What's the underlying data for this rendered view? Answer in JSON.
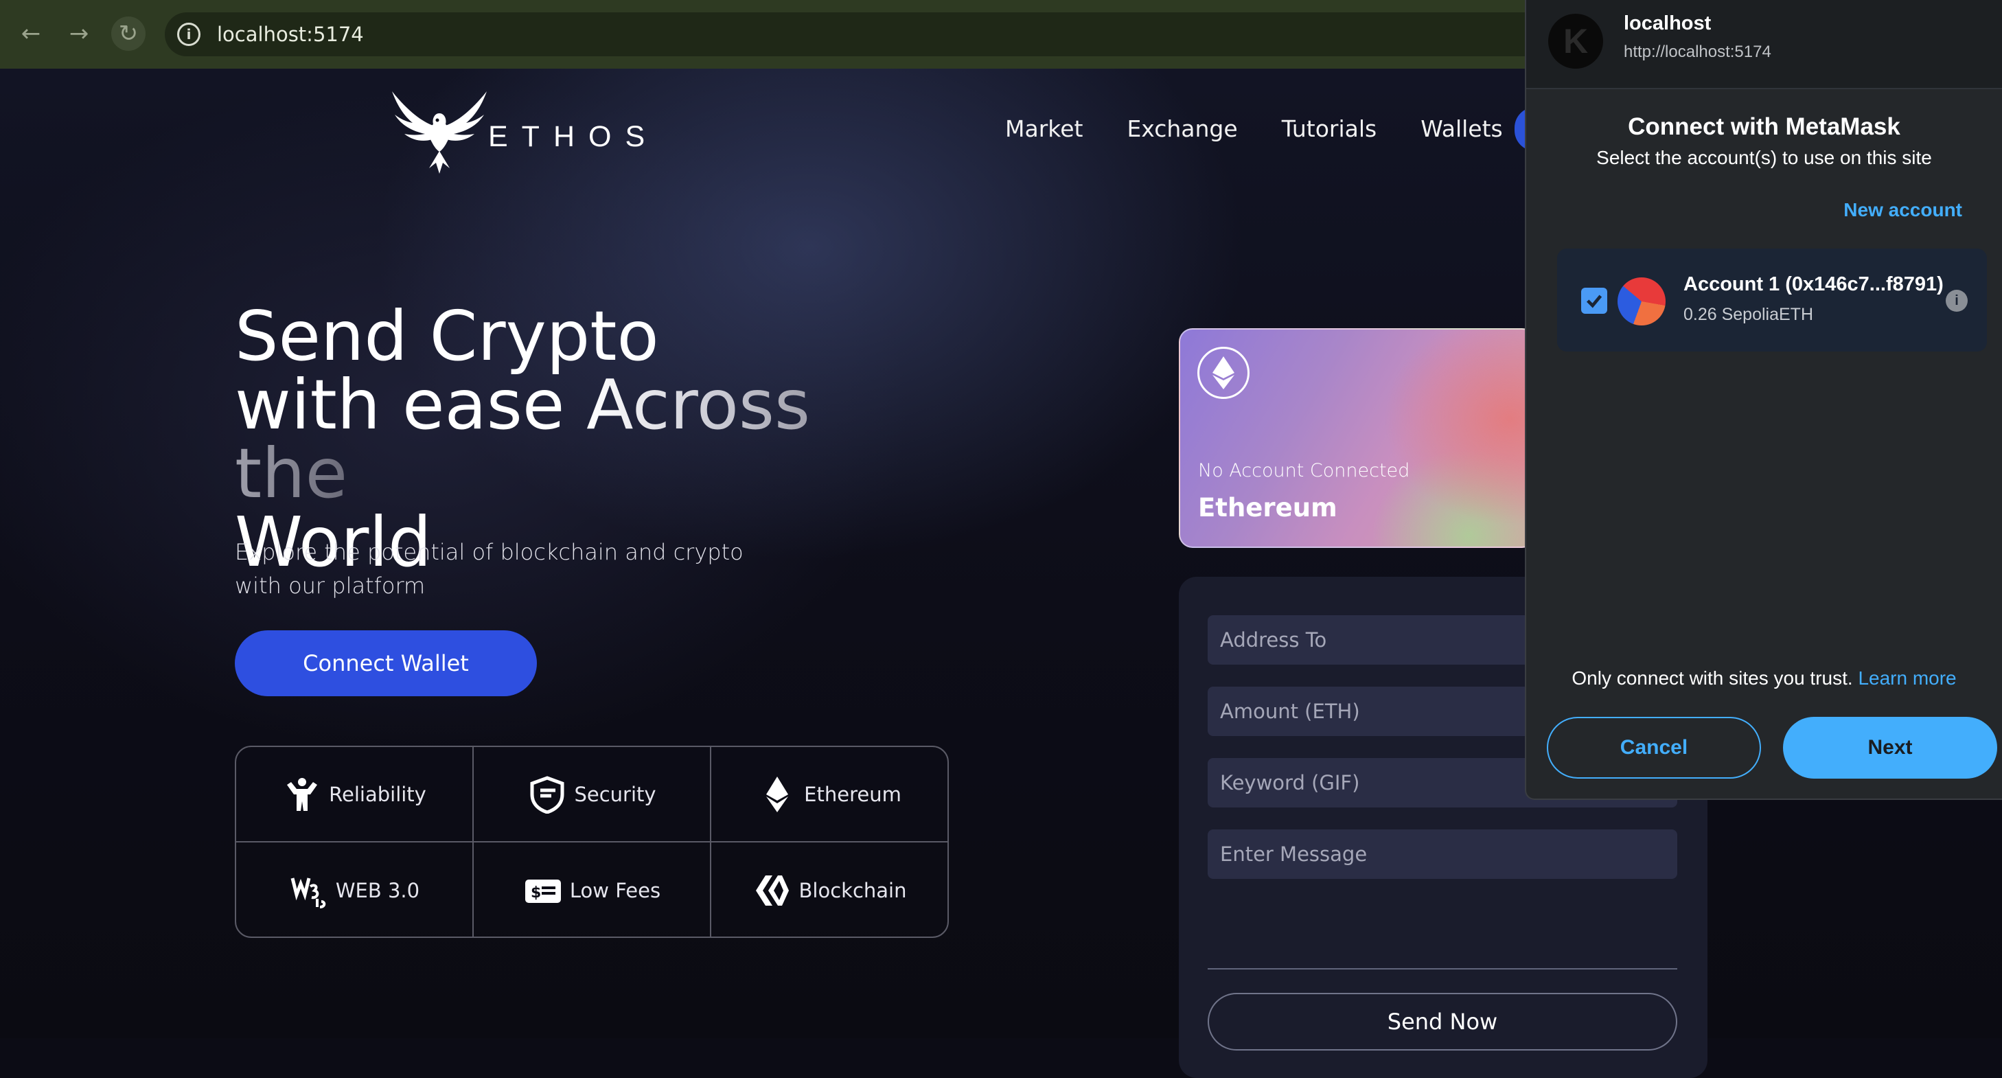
{
  "browser": {
    "url": "localhost:5174",
    "back_icon": "back-arrow-icon",
    "forward_icon": "forward-arrow-icon",
    "reload_icon": "reload-icon"
  },
  "site": {
    "logo_text": "ETHOS",
    "nav": [
      "Market",
      "Exchange",
      "Tutorials",
      "Wallets"
    ],
    "hero": {
      "line1": "Send Crypto",
      "line2_a": "with ease ",
      "line2_b": "Across the",
      "line3": "World",
      "subtitle": "Explore the potential of blockchain and crypto with our platform",
      "cta": "Connect Wallet"
    },
    "features": [
      {
        "label": "Reliability",
        "icon": "strength-icon"
      },
      {
        "label": "Security",
        "icon": "shield-icon"
      },
      {
        "label": "Ethereum",
        "icon": "ethereum-icon"
      },
      {
        "label": "WEB 3.0",
        "icon": "web3-icon"
      },
      {
        "label": "Low Fees",
        "icon": "money-icon"
      },
      {
        "label": "Blockchain",
        "icon": "blockchain-icon"
      }
    ],
    "card": {
      "status": "No Account Connected",
      "network": "Ethereum"
    },
    "form": {
      "address_placeholder": "Address To",
      "amount_placeholder": "Amount (ETH)",
      "keyword_placeholder": "Keyword (GIF)",
      "message_placeholder": "Enter Message",
      "submit": "Send Now"
    },
    "colors": {
      "accent": "#2e4fe0",
      "background": "#0c0c15"
    }
  },
  "metamask": {
    "site_avatar_letter": "K",
    "site_name": "localhost",
    "site_origin": "http://localhost:5174",
    "title": "Connect with MetaMask",
    "subtitle": "Select the account(s) to use on this site",
    "new_account": "New account",
    "account": {
      "name": "Account 1 (0x146c7...f8791)",
      "balance": "0.26 SepoliaETH",
      "selected": true
    },
    "trust_text": "Only connect with sites you trust. ",
    "learn_more": "Learn more",
    "cancel": "Cancel",
    "next": "Next",
    "colors": {
      "accent": "#43aefc",
      "panel": "#24272a"
    }
  }
}
